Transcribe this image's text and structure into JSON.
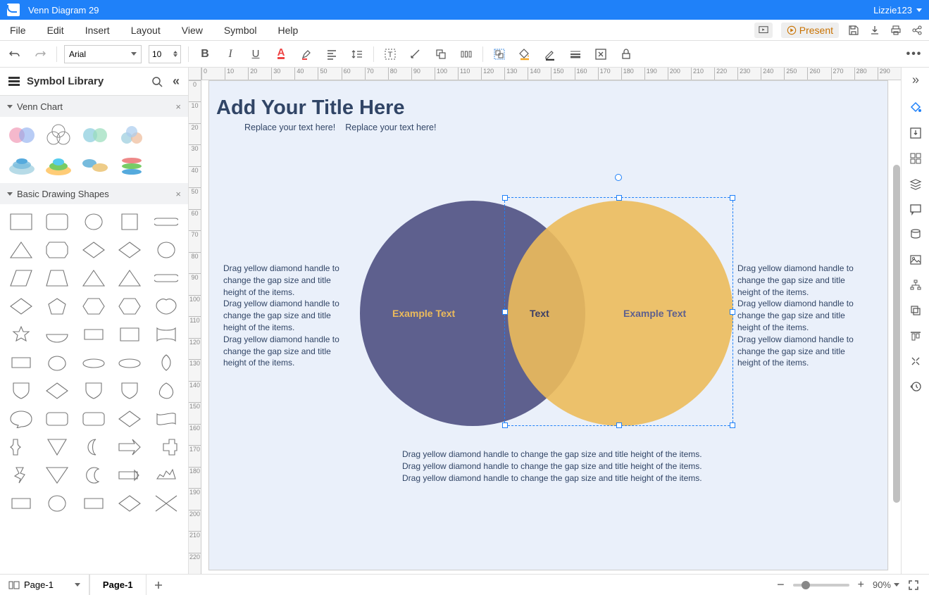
{
  "titlebar": {
    "doc_title": "Venn Diagram 29",
    "user": "Lizzie123"
  },
  "menu": {
    "file": "File",
    "edit": "Edit",
    "insert": "Insert",
    "layout": "Layout",
    "view": "View",
    "symbol": "Symbol",
    "help": "Help",
    "present": "Present"
  },
  "toolbar": {
    "font": "Arial",
    "font_size": "10"
  },
  "sidebar": {
    "library_title": "Symbol Library",
    "panel1": "Venn Chart",
    "panel2": "Basic Drawing Shapes"
  },
  "ruler_h": [
    "0",
    "10",
    "20",
    "30",
    "40",
    "50",
    "60",
    "70",
    "80",
    "90",
    "100",
    "110",
    "120",
    "130",
    "140",
    "150",
    "160",
    "170",
    "180",
    "190",
    "200",
    "210",
    "220",
    "230",
    "240",
    "250",
    "260",
    "270",
    "280",
    "290"
  ],
  "ruler_v": [
    "0",
    "10",
    "20",
    "30",
    "40",
    "50",
    "60",
    "70",
    "80",
    "90",
    "100",
    "110",
    "120",
    "130",
    "140",
    "150",
    "160",
    "170",
    "180",
    "190",
    "200",
    "210",
    "220"
  ],
  "canvas": {
    "title": "Add Your Title Here",
    "sub1": "Replace your text here!",
    "sub2": "Replace your text here!",
    "label_left": "Example Text",
    "label_center": "Text",
    "label_right": "Example Text",
    "desc_para": "Drag yellow diamond handle to change the gap size and title height of the items.",
    "colors": {
      "circle1": "#5e608e",
      "circle2": "#ecbb5b",
      "page_bg": "#eaf0fa"
    }
  },
  "status": {
    "page_current": "Page-1",
    "tab1": "Page-1",
    "zoom": "90%"
  }
}
